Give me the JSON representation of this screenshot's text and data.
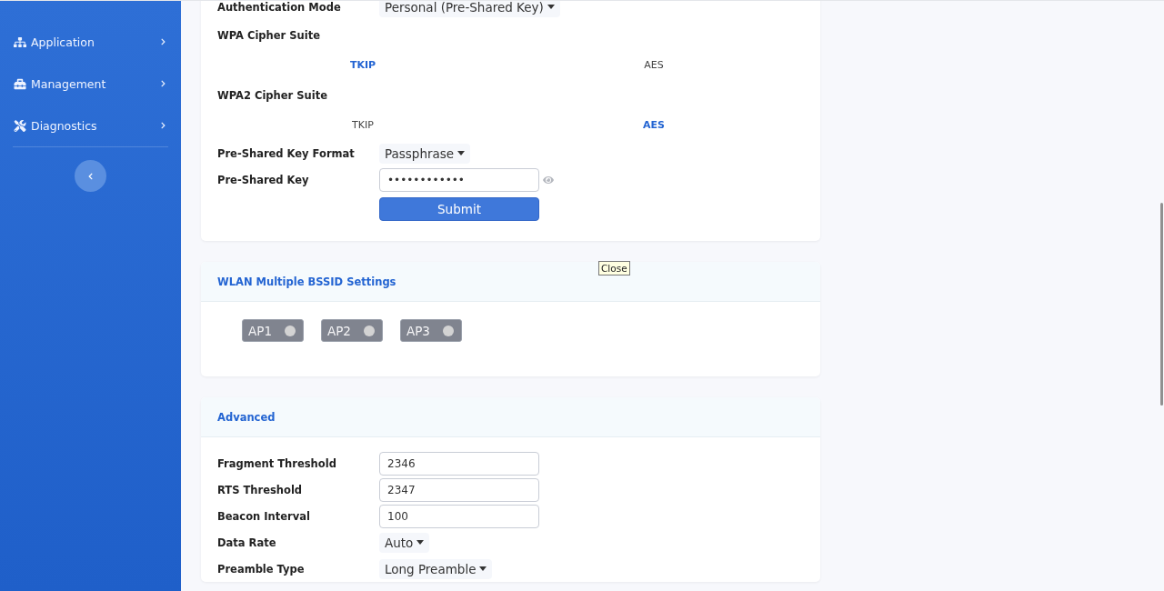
{
  "sidebar": {
    "items": [
      {
        "label": "Application"
      },
      {
        "label": "Management"
      },
      {
        "label": "Diagnostics"
      }
    ]
  },
  "security": {
    "rows": [
      {
        "kind": "select",
        "label": "Authentication Mode",
        "value": "Personal (Pre-Shared Key)"
      },
      {
        "kind": "choice",
        "label": "WPA Cipher Suite",
        "options": [
          {
            "label": "TKIP",
            "selected": true
          },
          {
            "label": "AES",
            "selected": false
          }
        ]
      },
      {
        "kind": "choice",
        "label": "WPA2 Cipher Suite",
        "options": [
          {
            "label": "TKIP",
            "selected": false
          },
          {
            "label": "AES",
            "selected": true
          }
        ]
      },
      {
        "kind": "select",
        "label": "Pre-Shared Key Format",
        "value": "Passphrase"
      },
      {
        "kind": "password",
        "label": "Pre-Shared Key",
        "value": "••••••••••••"
      }
    ],
    "submit": "Submit"
  },
  "tooltip": "Close",
  "bssid": {
    "title": "WLAN Multiple BSSID Settings",
    "toggles": [
      {
        "label": "AP1",
        "on": false
      },
      {
        "label": "AP2",
        "on": false
      },
      {
        "label": "AP3",
        "on": false
      }
    ]
  },
  "advanced": {
    "title": "Advanced",
    "rows": [
      {
        "kind": "input",
        "label": "Fragment Threshold",
        "value": "2346"
      },
      {
        "kind": "input",
        "label": "RTS Threshold",
        "value": "2347"
      },
      {
        "kind": "input",
        "label": "Beacon Interval",
        "value": "100"
      },
      {
        "kind": "select",
        "label": "Data Rate",
        "value": "Auto"
      },
      {
        "kind": "select",
        "label": "Preamble Type",
        "value": "Long Preamble"
      }
    ]
  }
}
